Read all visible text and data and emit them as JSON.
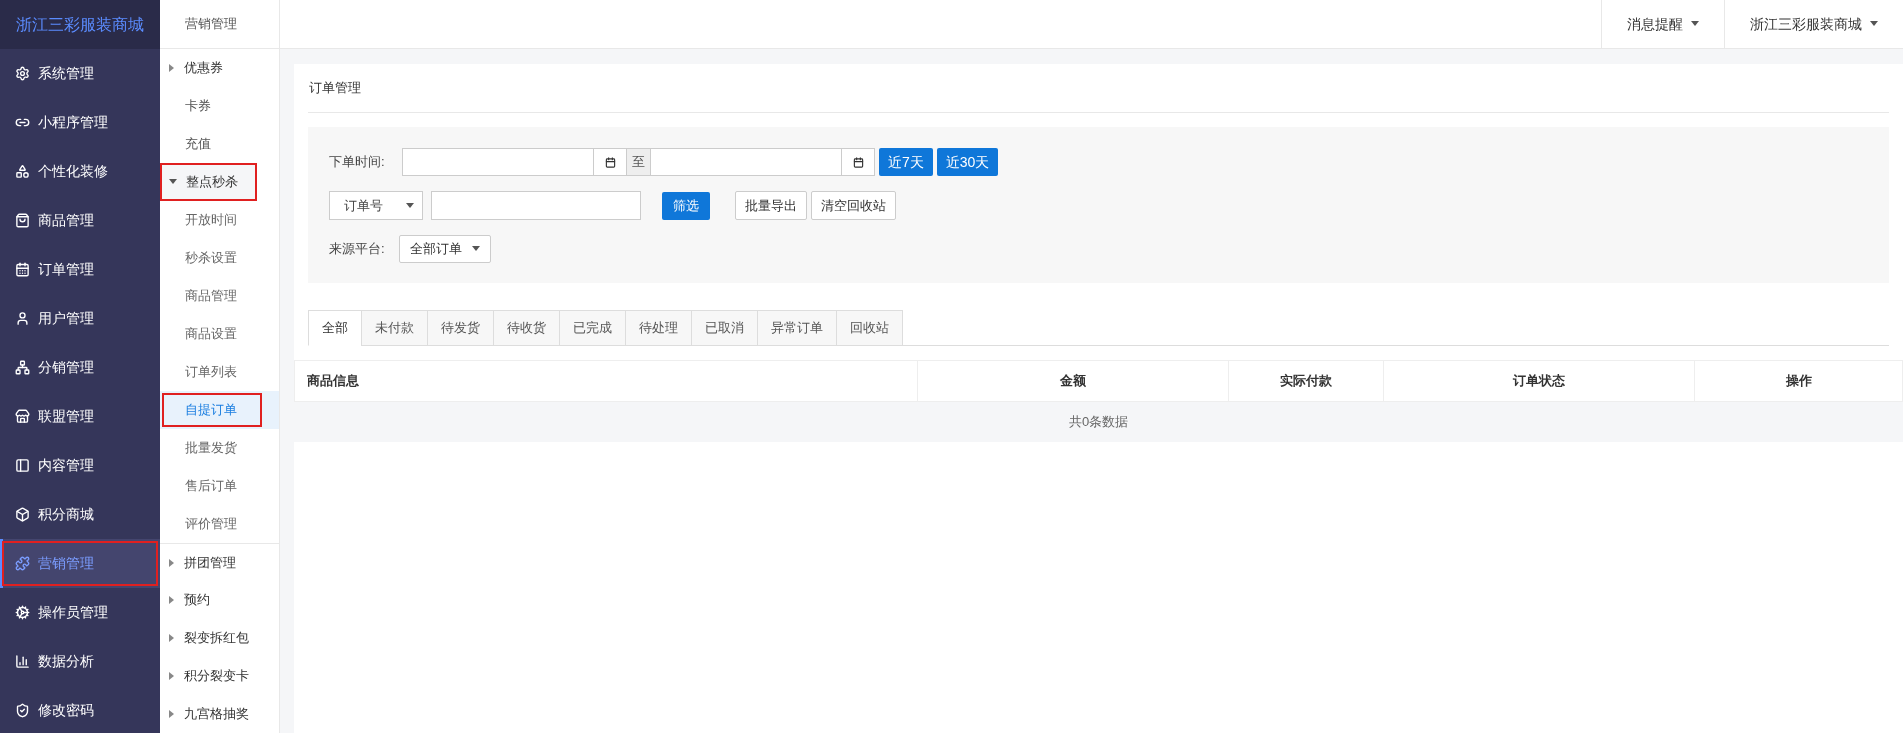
{
  "brand": "浙江三彩服装商城",
  "main_menu": [
    {
      "label": "系统管理",
      "selected": false,
      "highlighted": false
    },
    {
      "label": "小程序管理",
      "selected": false,
      "highlighted": false
    },
    {
      "label": "个性化装修",
      "selected": false,
      "highlighted": false
    },
    {
      "label": "商品管理",
      "selected": false,
      "highlighted": false
    },
    {
      "label": "订单管理",
      "selected": false,
      "highlighted": false
    },
    {
      "label": "用户管理",
      "selected": false,
      "highlighted": false
    },
    {
      "label": "分销管理",
      "selected": false,
      "highlighted": false
    },
    {
      "label": "联盟管理",
      "selected": false,
      "highlighted": false
    },
    {
      "label": "内容管理",
      "selected": false,
      "highlighted": false
    },
    {
      "label": "积分商城",
      "selected": false,
      "highlighted": false
    },
    {
      "label": "营销管理",
      "selected": true,
      "highlighted": true
    },
    {
      "label": "操作员管理",
      "selected": false,
      "highlighted": false
    },
    {
      "label": "数据分析",
      "selected": false,
      "highlighted": false
    },
    {
      "label": "修改密码",
      "selected": false,
      "highlighted": false
    }
  ],
  "sub_menu": {
    "title": "营销管理",
    "items": [
      {
        "kind": "group",
        "label": "优惠券",
        "expanded": false,
        "highlighted": false
      },
      {
        "kind": "leaf",
        "label": "卡券",
        "selected": false,
        "highlighted": false
      },
      {
        "kind": "leaf",
        "label": "充值",
        "selected": false,
        "highlighted": false
      },
      {
        "kind": "group",
        "label": "整点秒杀",
        "expanded": true,
        "highlighted": true,
        "children": [
          {
            "label": "开放时间",
            "selected": false,
            "highlighted": false
          },
          {
            "label": "秒杀设置",
            "selected": false,
            "highlighted": false
          },
          {
            "label": "商品管理",
            "selected": false,
            "highlighted": false
          },
          {
            "label": "商品设置",
            "selected": false,
            "highlighted": false
          },
          {
            "label": "订单列表",
            "selected": false,
            "highlighted": false
          },
          {
            "label": "自提订单",
            "selected": true,
            "highlighted": true
          },
          {
            "label": "批量发货",
            "selected": false,
            "highlighted": false
          },
          {
            "label": "售后订单",
            "selected": false,
            "highlighted": false
          },
          {
            "label": "评价管理",
            "selected": false,
            "highlighted": false
          }
        ]
      },
      {
        "kind": "group",
        "label": "拼团管理",
        "expanded": false,
        "highlighted": false
      },
      {
        "kind": "group",
        "label": "预约",
        "expanded": false,
        "highlighted": false
      },
      {
        "kind": "group",
        "label": "裂变拆红包",
        "expanded": false,
        "highlighted": false
      },
      {
        "kind": "group",
        "label": "积分裂变卡",
        "expanded": false,
        "highlighted": false
      },
      {
        "kind": "group",
        "label": "九宫格抽奖",
        "expanded": false,
        "highlighted": false
      }
    ]
  },
  "top_bar": {
    "items": [
      "消息提醒",
      "浙江三彩服装商城"
    ]
  },
  "page_title": "订单管理",
  "filters": {
    "date_label": "下单时间:",
    "date_separator": "至",
    "quick_buttons": [
      "近7天",
      "近30天"
    ],
    "search_type": "订单号",
    "filter_button": "筛选",
    "action_buttons": [
      "批量导出",
      "清空回收站"
    ],
    "source_label": "来源平台:",
    "source_value": "全部订单"
  },
  "tabs": [
    {
      "label": "全部",
      "selected": true
    },
    {
      "label": "未付款",
      "selected": false
    },
    {
      "label": "待发货",
      "selected": false
    },
    {
      "label": "待收货",
      "selected": false
    },
    {
      "label": "已完成",
      "selected": false
    },
    {
      "label": "待处理",
      "selected": false
    },
    {
      "label": "已取消",
      "selected": false
    },
    {
      "label": "异常订单",
      "selected": false
    },
    {
      "label": "回收站",
      "selected": false
    }
  ],
  "table": {
    "columns": [
      "商品信息",
      "金额",
      "实际付款",
      "订单状态",
      "操作"
    ],
    "empty_text": "共0条数据"
  }
}
